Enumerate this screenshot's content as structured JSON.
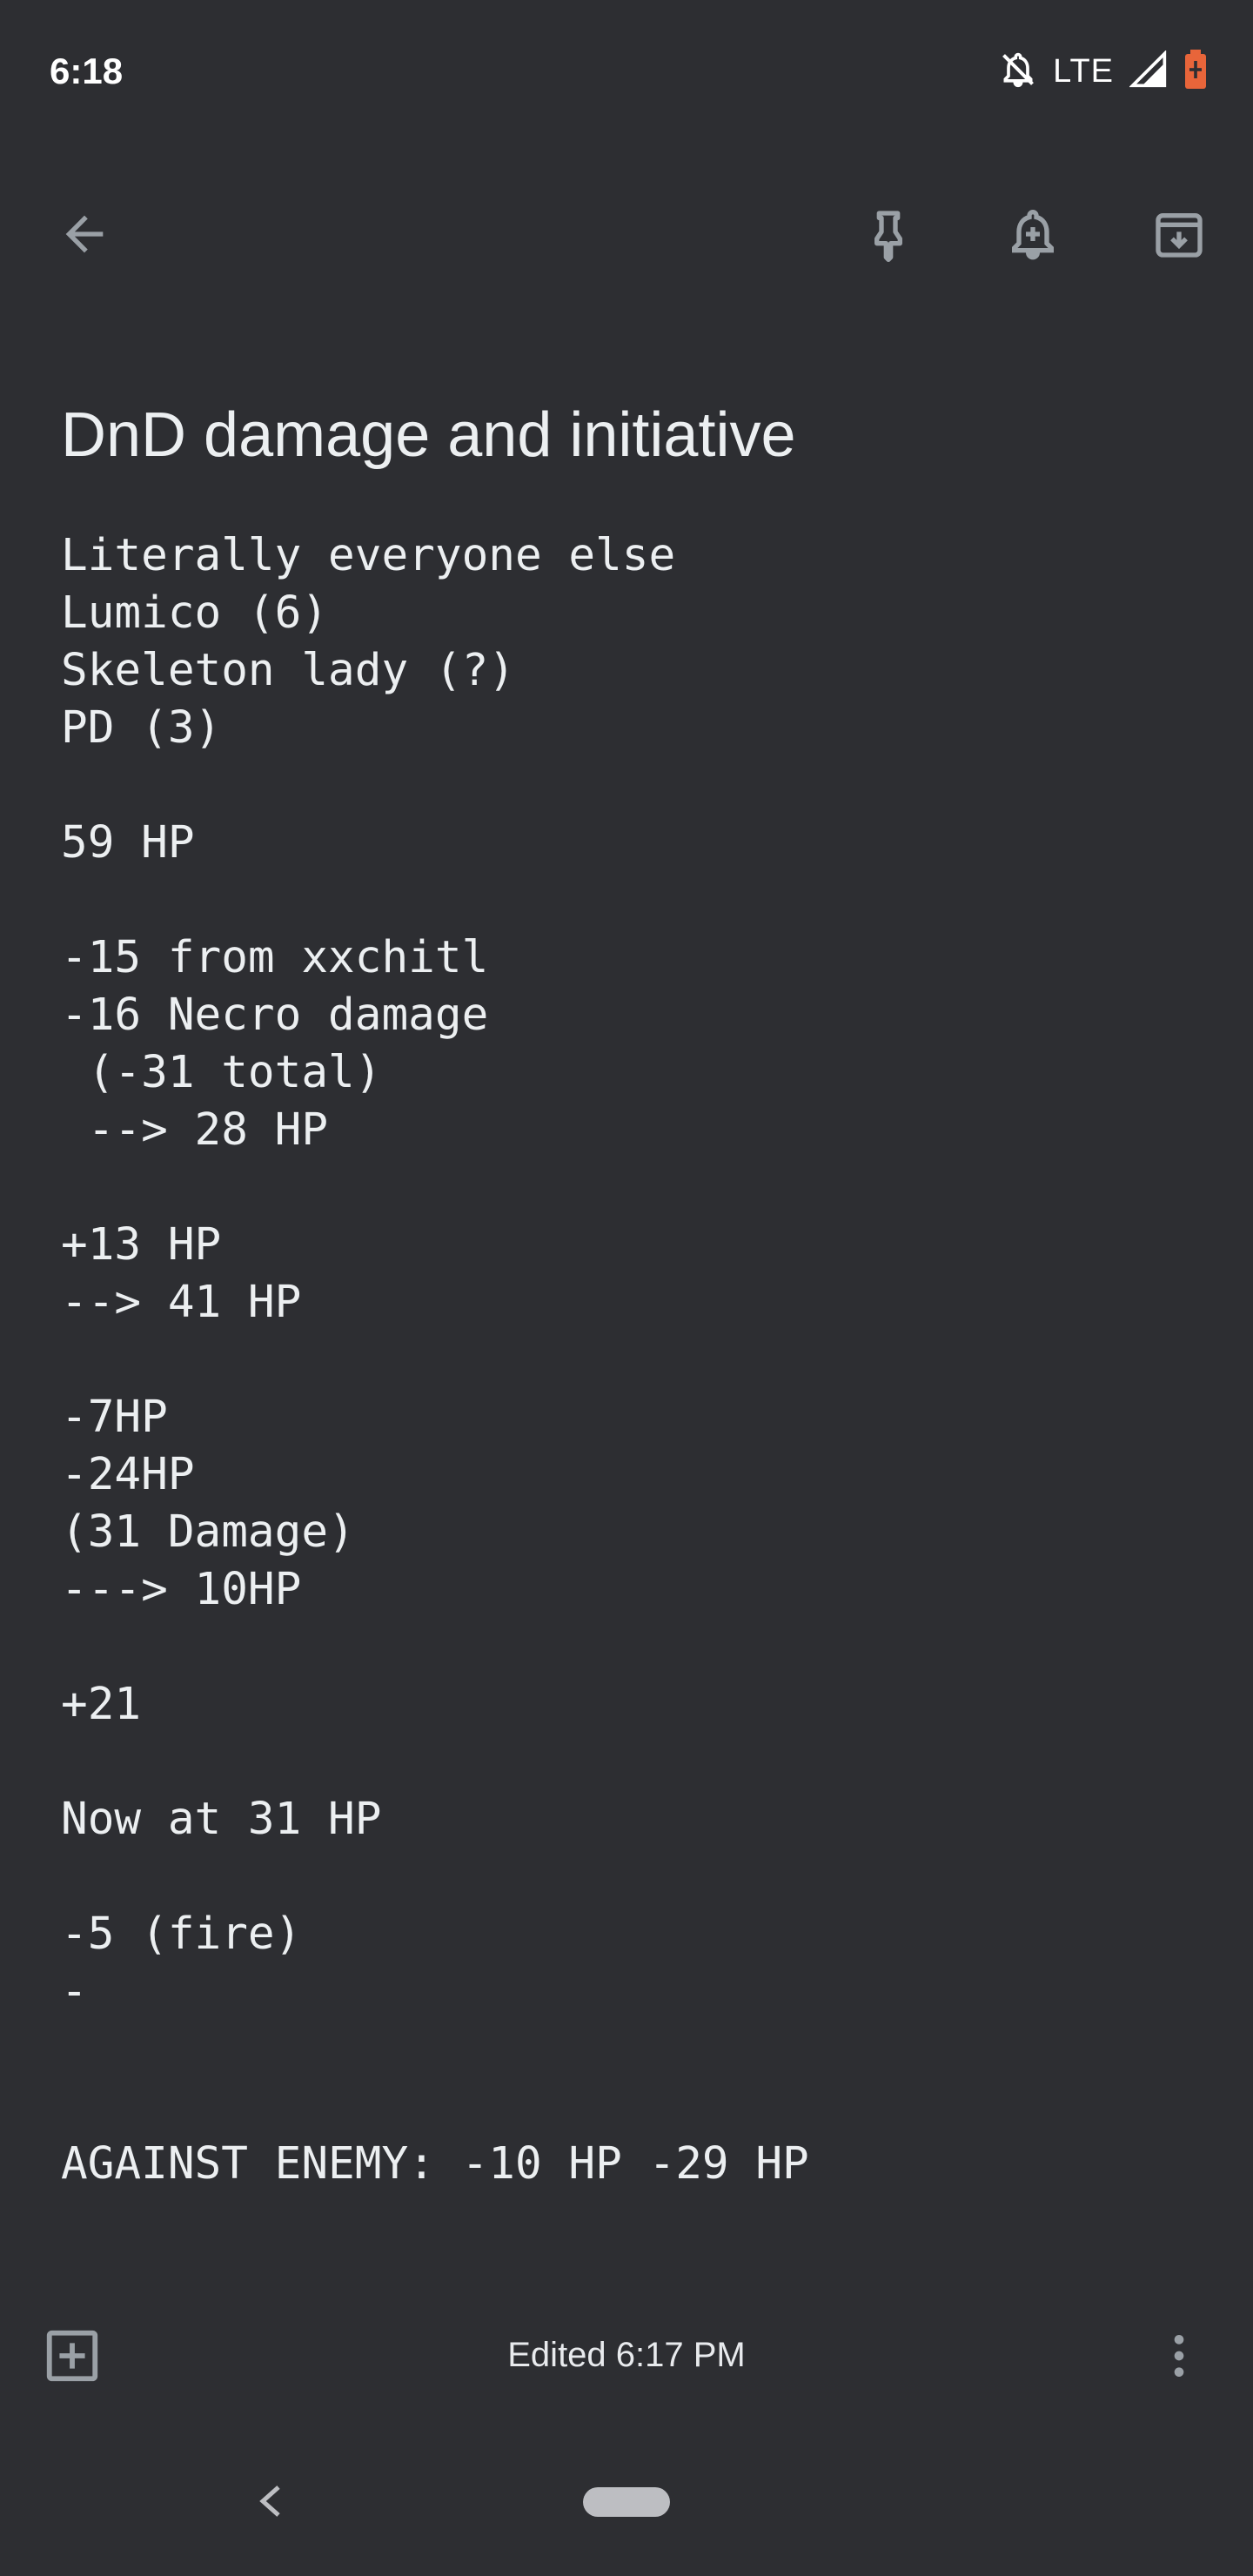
{
  "status_bar": {
    "time": "6:18",
    "network": "LTE",
    "icons": [
      "notifications-off-icon",
      "signal-icon",
      "battery-icon"
    ],
    "battery_color": "#e8653a"
  },
  "toolbar": {
    "icons": [
      "back-arrow-icon",
      "pin-icon",
      "add-reminder-icon",
      "archive-icon"
    ]
  },
  "note": {
    "title": "DnD damage and initiative",
    "body": "Literally everyone else\nLumico (6)\nSkeleton lady (?)\nPD (3)\n\n59 HP\n\n-15 from xxchitl\n-16 Necro damage\n (-31 total)\n --> 28 HP\n\n+13 HP\n--> 41 HP\n\n-7HP\n-24HP\n(31 Damage)\n---> 10HP\n\n+21\n\nNow at 31 HP\n\n-5 (fire)\n-\n\n\nAGAINST ENEMY: -10 HP -29 HP"
  },
  "bottom_bar": {
    "edited": "Edited 6:17 PM",
    "icons": [
      "add-box-icon",
      "more-vert-icon"
    ]
  },
  "colors": {
    "background": "#2d2e32",
    "text": "#eceff1",
    "icon": "#9aa0a6"
  }
}
